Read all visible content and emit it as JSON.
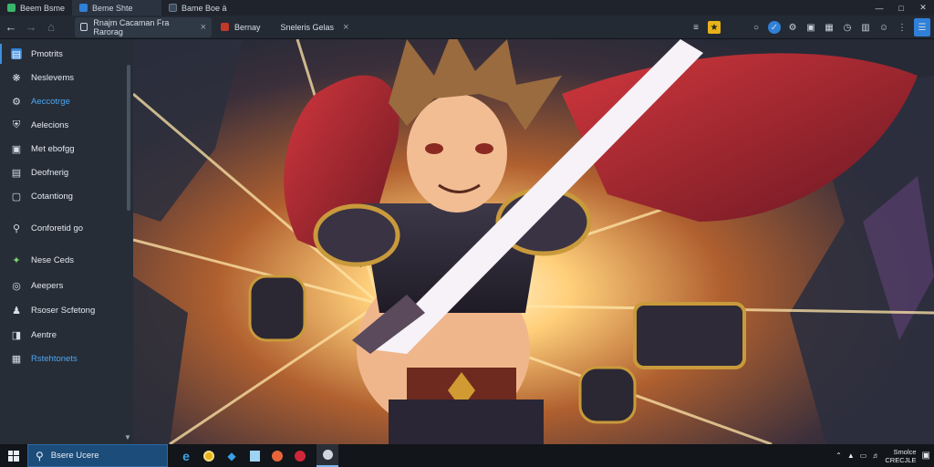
{
  "titlebar": {
    "tabs": [
      {
        "label": "Beem Bsme",
        "active": false
      },
      {
        "label": "Beme Shte",
        "active": true
      },
      {
        "label": "Bame Boe  ä",
        "active": false
      }
    ]
  },
  "toolbar": {
    "back_icon": "arrow-left-icon",
    "doc_tabs": [
      {
        "label": "Rnajm Cacaman Fra Rarorag",
        "active": true
      },
      {
        "label": "Bernay",
        "active": false
      },
      {
        "label": "Sneleris Gelas",
        "active": false
      }
    ]
  },
  "sidebar": {
    "items": [
      {
        "label": "Pmotrits",
        "icon": "store-icon",
        "highlight": false
      },
      {
        "label": "Neslevems",
        "icon": "bug-icon",
        "highlight": false
      },
      {
        "label": "Aeccotrge",
        "icon": "gear-icon",
        "highlight": true
      },
      {
        "label": "Aelecions",
        "icon": "shield-icon",
        "highlight": false
      },
      {
        "label": "Met ebofgg",
        "icon": "monitor-icon",
        "highlight": false
      },
      {
        "label": "Deofnerig",
        "icon": "document-icon",
        "highlight": false
      },
      {
        "label": "Cotantiong",
        "icon": "folder-icon",
        "highlight": false
      },
      {
        "label": "Conforetid go",
        "icon": "microphone-icon",
        "highlight": false
      },
      {
        "label": "Nese Ceds",
        "icon": "bolt-icon",
        "highlight": false
      },
      {
        "label": "Aeepers",
        "icon": "compass-icon",
        "highlight": false
      },
      {
        "label": "Rsoser Scfetong",
        "icon": "user-icon",
        "highlight": false
      },
      {
        "label": "Aentre",
        "icon": "window-icon",
        "highlight": false
      },
      {
        "label": "Rstehtonets",
        "icon": "layout-icon",
        "highlight": true
      }
    ]
  },
  "taskbar": {
    "search_text": "Bsere Ucere",
    "apps": [
      "edge-icon",
      "chrome-icon",
      "store-icon",
      "files-icon",
      "media-icon",
      "opera-icon",
      "steam-icon"
    ]
  },
  "tray": {
    "clock_top": "Smolce",
    "clock_bottom": "CRECJLE"
  },
  "colors": {
    "accent": "#3d8fe0",
    "sidebar_bg": "#262d37",
    "taskbar_bg": "#121519"
  }
}
